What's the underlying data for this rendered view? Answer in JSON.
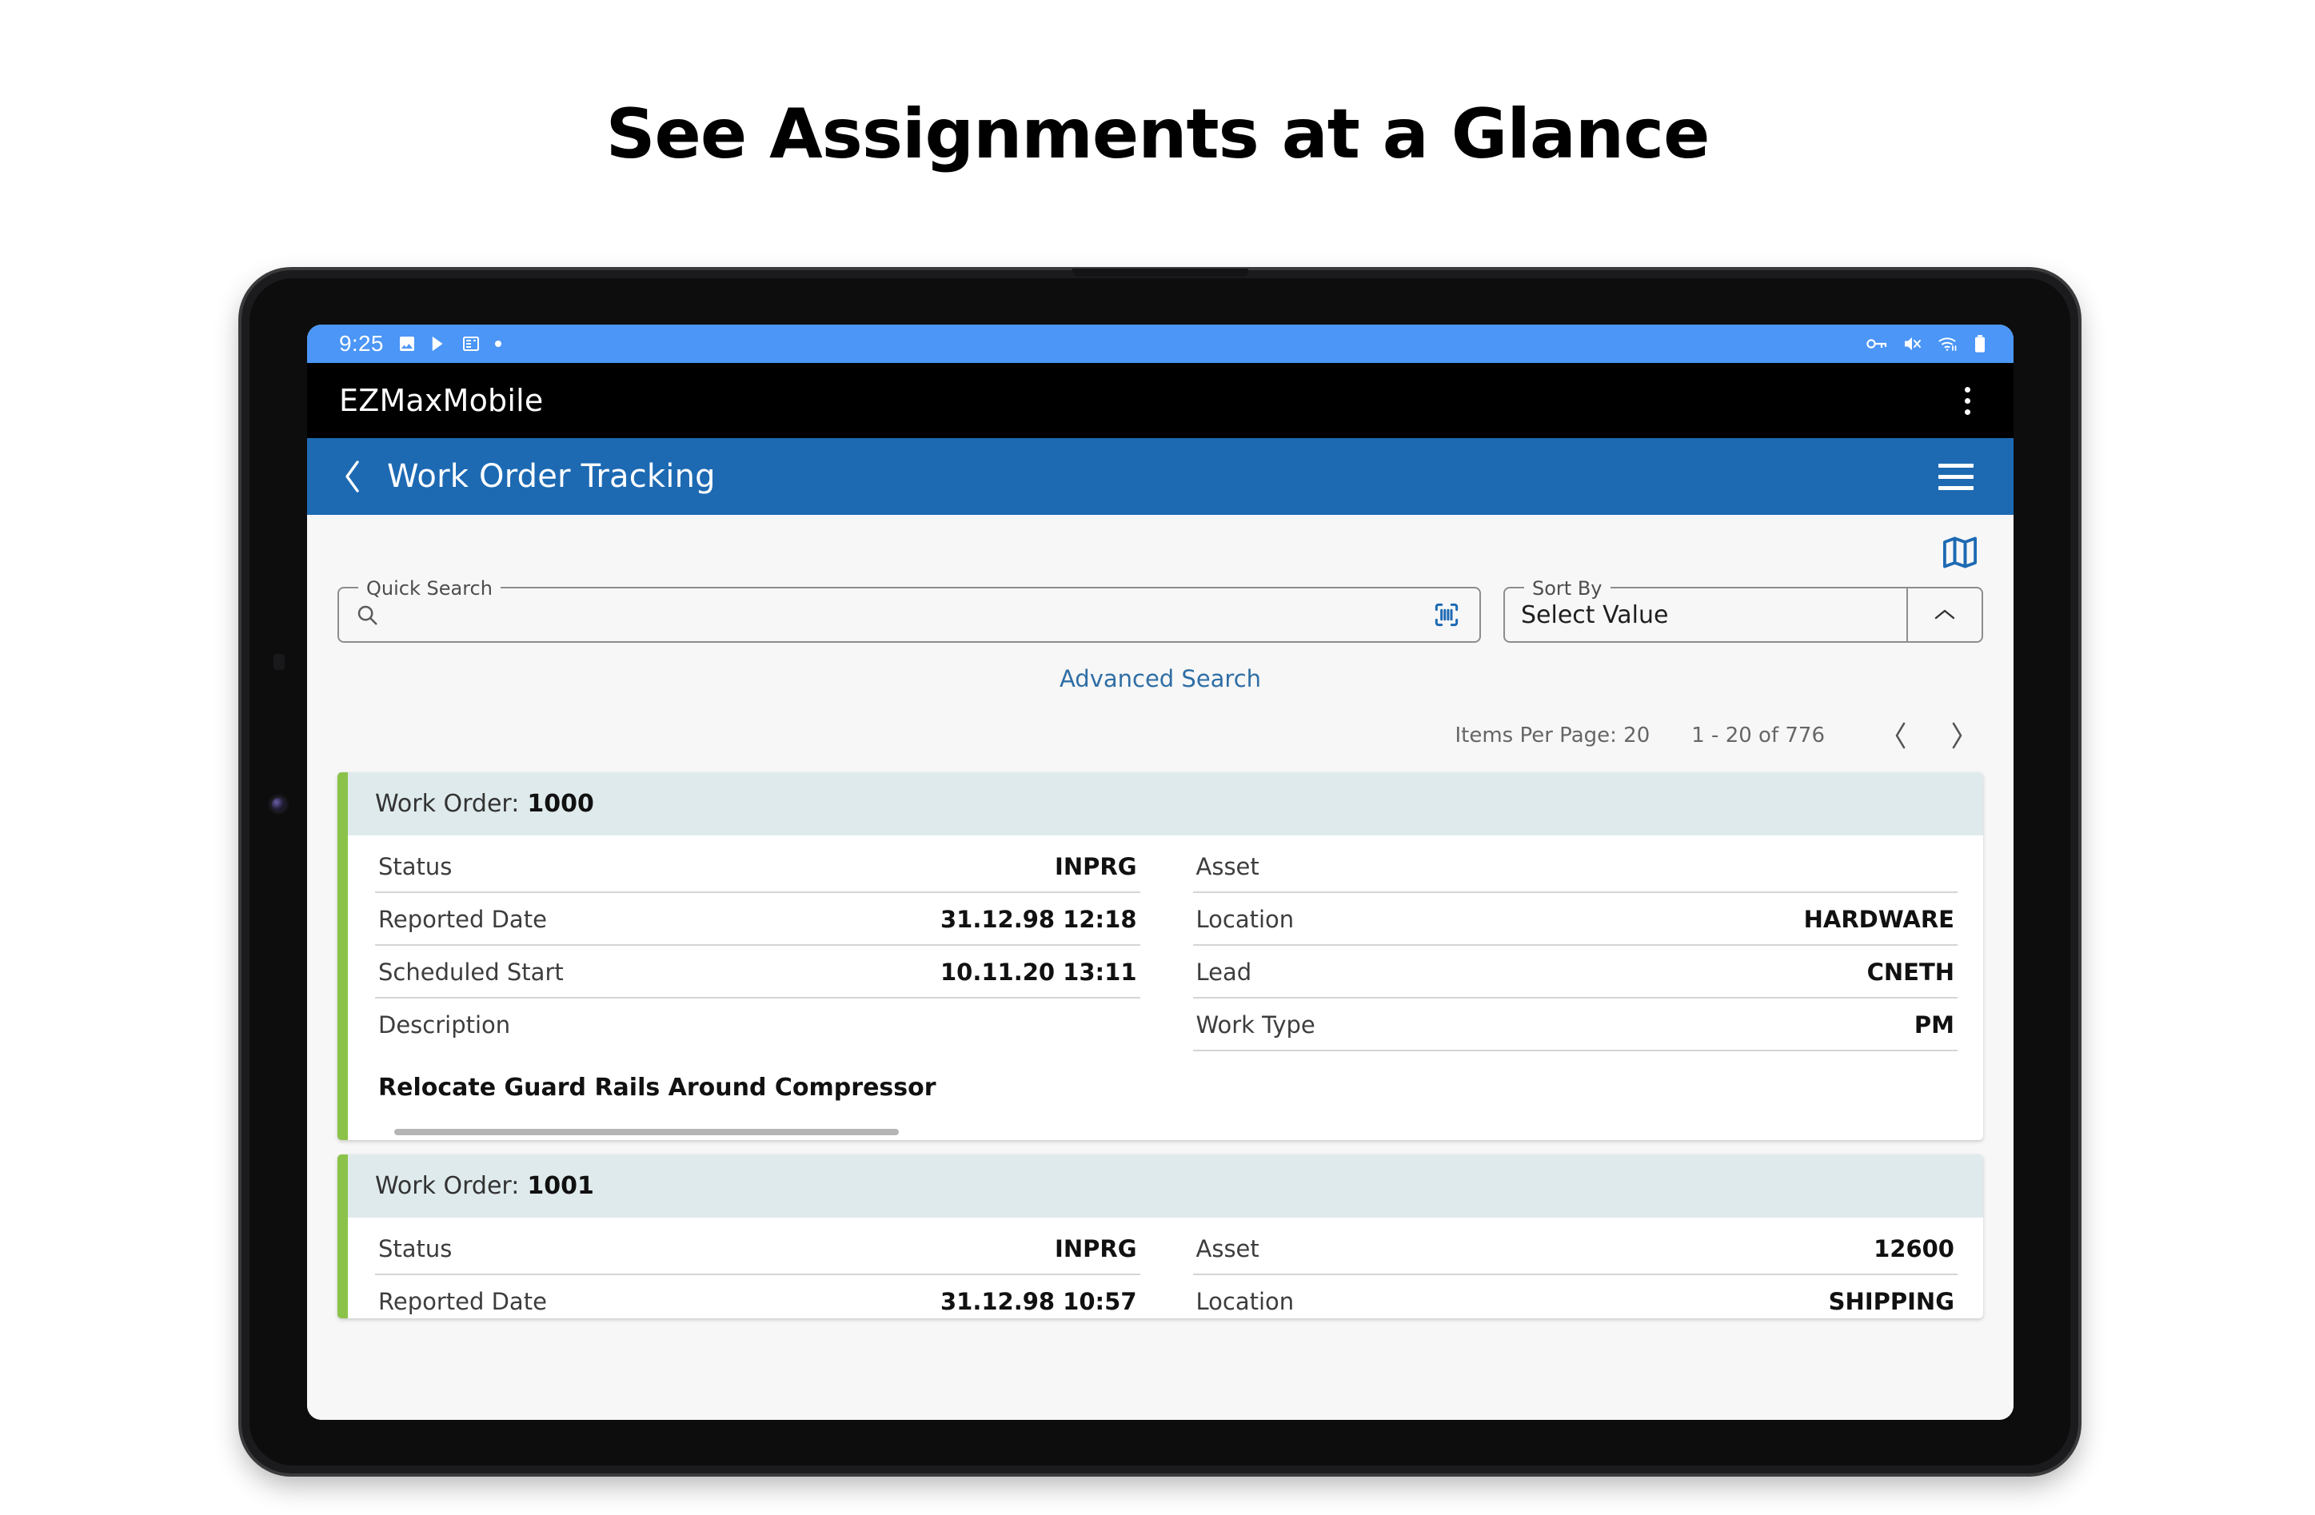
{
  "headline": "See Assignments at a Glance",
  "status_bar": {
    "time": "9:25",
    "left_icons": [
      "image-icon",
      "play-store-icon",
      "news-icon",
      "dot-icon"
    ],
    "right_icons": [
      "vpn-key-icon",
      "mute-icon",
      "wifi-icon",
      "battery-icon"
    ]
  },
  "app_bar": {
    "title": "EZMaxMobile",
    "menu_icon": "kebab-menu-icon"
  },
  "toolbar": {
    "back_icon": "back-chevron-icon",
    "title": "Work Order Tracking",
    "menu_icon": "hamburger-menu-icon"
  },
  "actions": {
    "map_icon": "map-icon"
  },
  "search": {
    "quick_search_label": "Quick Search",
    "quick_search_value": "",
    "quick_search_placeholder": "",
    "search_icon": "search-icon",
    "barcode_icon": "barcode-scan-icon",
    "advanced_search": "Advanced Search"
  },
  "sort": {
    "label": "Sort By",
    "value": "Select Value",
    "caret_icon": "chevron-up-icon"
  },
  "pagination": {
    "items_per_page": "Items Per Page: 20",
    "range": "1 - 20 of 776",
    "prev_icon": "chevron-left-icon",
    "next_icon": "chevron-right-icon"
  },
  "list": {
    "work_order_label": "Work Order:",
    "cards": [
      {
        "id": "1000",
        "left": [
          {
            "key": "Status",
            "value": "INPRG"
          },
          {
            "key": "Reported Date",
            "value": "31.12.98 12:18"
          },
          {
            "key": "Scheduled Start",
            "value": "10.11.20 13:11"
          },
          {
            "key": "Description",
            "value": ""
          }
        ],
        "right": [
          {
            "key": "Asset",
            "value": ""
          },
          {
            "key": "Location",
            "value": "HARDWARE"
          },
          {
            "key": "Lead",
            "value": "CNETH"
          },
          {
            "key": "Work Type",
            "value": "PM"
          }
        ],
        "description": "Relocate Guard Rails Around Compressor"
      },
      {
        "id": "1001",
        "left": [
          {
            "key": "Status",
            "value": "INPRG"
          },
          {
            "key": "Reported Date",
            "value": "31.12.98 10:57"
          }
        ],
        "right": [
          {
            "key": "Asset",
            "value": "12600"
          },
          {
            "key": "Location",
            "value": "SHIPPING"
          }
        ],
        "description": ""
      }
    ]
  },
  "nav_bar": {
    "recents_icon": "recents-icon",
    "home_icon": "home-icon",
    "back_icon": "nav-back-icon"
  },
  "colors": {
    "status_bar": "#4b96f6",
    "app_bar": "#000000",
    "toolbar": "#1d6ab3",
    "accent_blue": "#1d6ab3",
    "link_blue": "#2f6ea5",
    "card_accent_green": "#8bc34a",
    "card_header": "#dfeaec"
  }
}
